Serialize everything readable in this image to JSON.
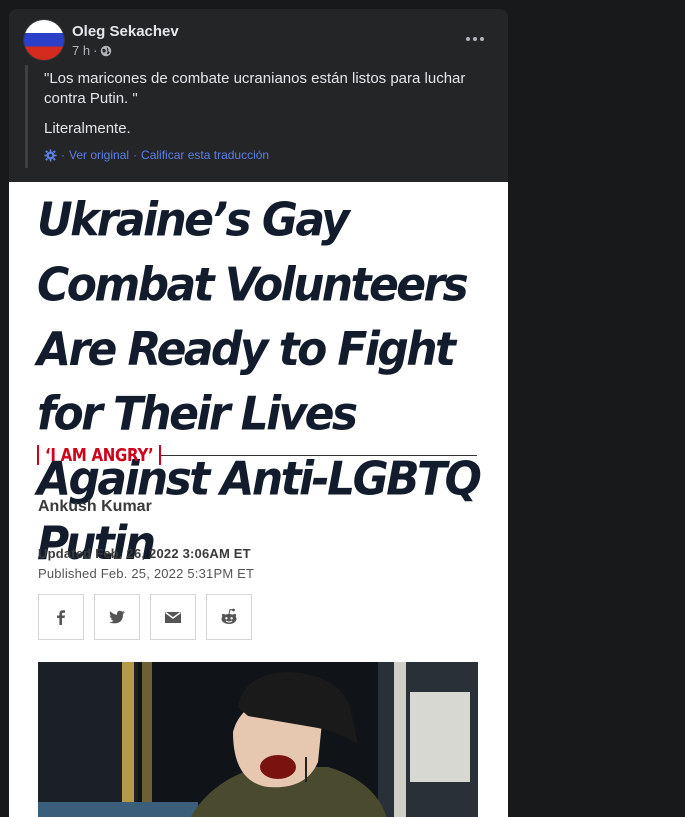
{
  "post": {
    "author": "Oleg Sekachev",
    "time": "7 h",
    "separator": "·",
    "translation": {
      "text": "\"Los maricones de combate ucranianos están listos para luchar contra Putin. \"",
      "text2": "Literalmente.",
      "see_original": "Ver original",
      "rate_translation": "Calificar esta traducción",
      "link_separator": "·"
    }
  },
  "article": {
    "headline": "Ukraine’s Gay Combat Volunteers Are Ready to Fight for Their Lives Against Anti-LGBTQ Putin",
    "kicker": "‘I AM ANGRY’",
    "author": "Ankush Kumar",
    "updated": "Updated Feb. 26, 2022 3:06AM ET",
    "published": "Published Feb. 25, 2022 5:31PM ET",
    "share_buttons": [
      "facebook-icon",
      "twitter-icon",
      "email-icon",
      "reddit-icon"
    ]
  },
  "colors": {
    "page_bg": "#18191a",
    "card_bg": "#242526",
    "link": "#5b7fe8",
    "headline": "#121c2c",
    "kicker": "#d0021b"
  }
}
